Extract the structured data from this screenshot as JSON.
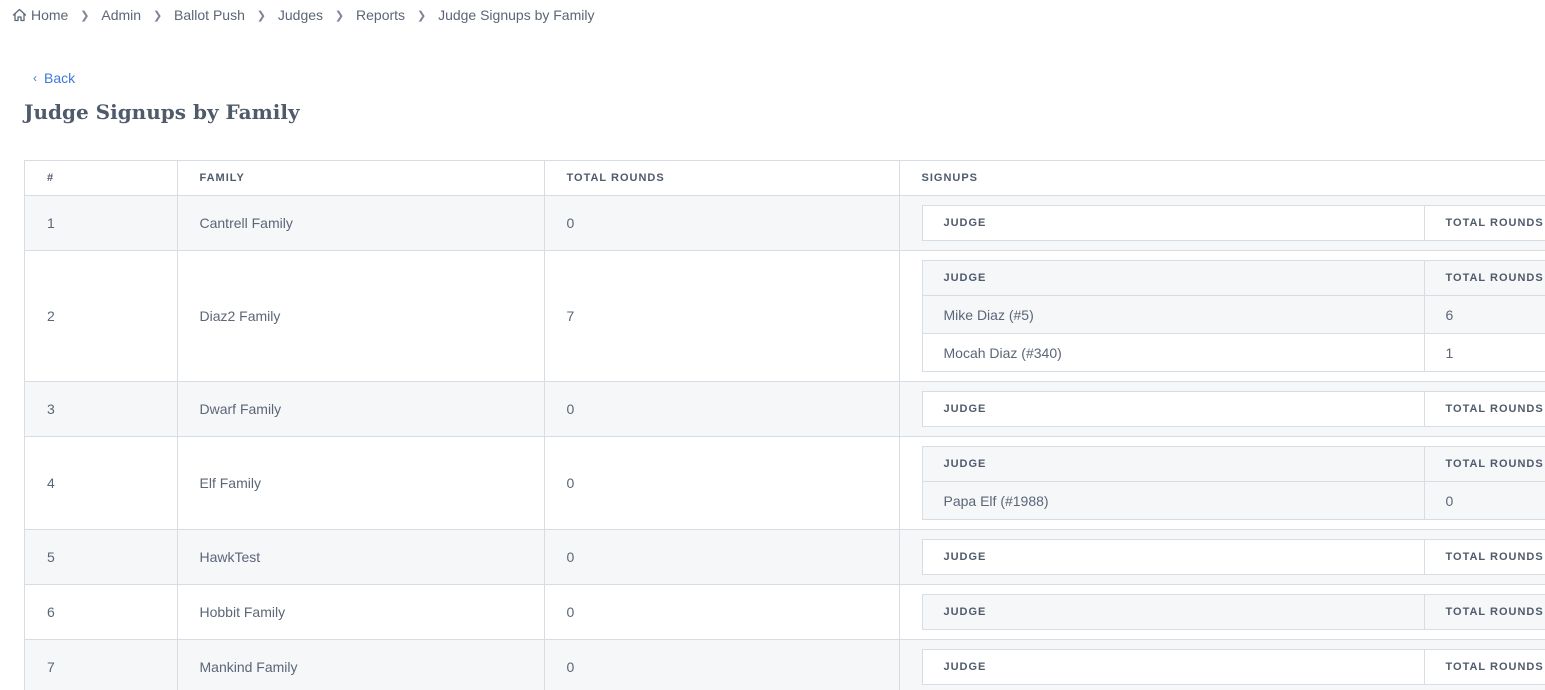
{
  "breadcrumb": [
    {
      "label": "Home",
      "icon": "home-icon"
    },
    {
      "label": "Admin"
    },
    {
      "label": "Ballot Push"
    },
    {
      "label": "Judges"
    },
    {
      "label": "Reports"
    },
    {
      "label": "Judge Signups by Family"
    }
  ],
  "back_label": "Back",
  "page_title": "Judge Signups by Family",
  "columns": [
    "#",
    "FAMILY",
    "TOTAL ROUNDS",
    "SIGNUPS"
  ],
  "signup_columns": [
    "JUDGE",
    "TOTAL ROUNDS"
  ],
  "colors": {
    "accent": "#3d7ad6",
    "text": "#5b6677",
    "heading": "#4f5a6b",
    "border": "#d8dde3",
    "stripe": "#f6f7f9"
  },
  "rows": [
    {
      "num": "1",
      "family": "Cantrell Family",
      "total_rounds": "0",
      "signups": []
    },
    {
      "num": "2",
      "family": "Diaz2 Family",
      "total_rounds": "7",
      "signups": [
        {
          "judge": "Mike Diaz (#5)",
          "rounds": "6"
        },
        {
          "judge": "Mocah Diaz (#340)",
          "rounds": "1"
        }
      ]
    },
    {
      "num": "3",
      "family": "Dwarf Family",
      "total_rounds": "0",
      "signups": []
    },
    {
      "num": "4",
      "family": "Elf Family",
      "total_rounds": "0",
      "signups": [
        {
          "judge": "Papa Elf (#1988)",
          "rounds": "0"
        }
      ]
    },
    {
      "num": "5",
      "family": "HawkTest",
      "total_rounds": "0",
      "signups": []
    },
    {
      "num": "6",
      "family": "Hobbit Family",
      "total_rounds": "0",
      "signups": []
    },
    {
      "num": "7",
      "family": "Mankind Family",
      "total_rounds": "0",
      "signups": []
    }
  ]
}
